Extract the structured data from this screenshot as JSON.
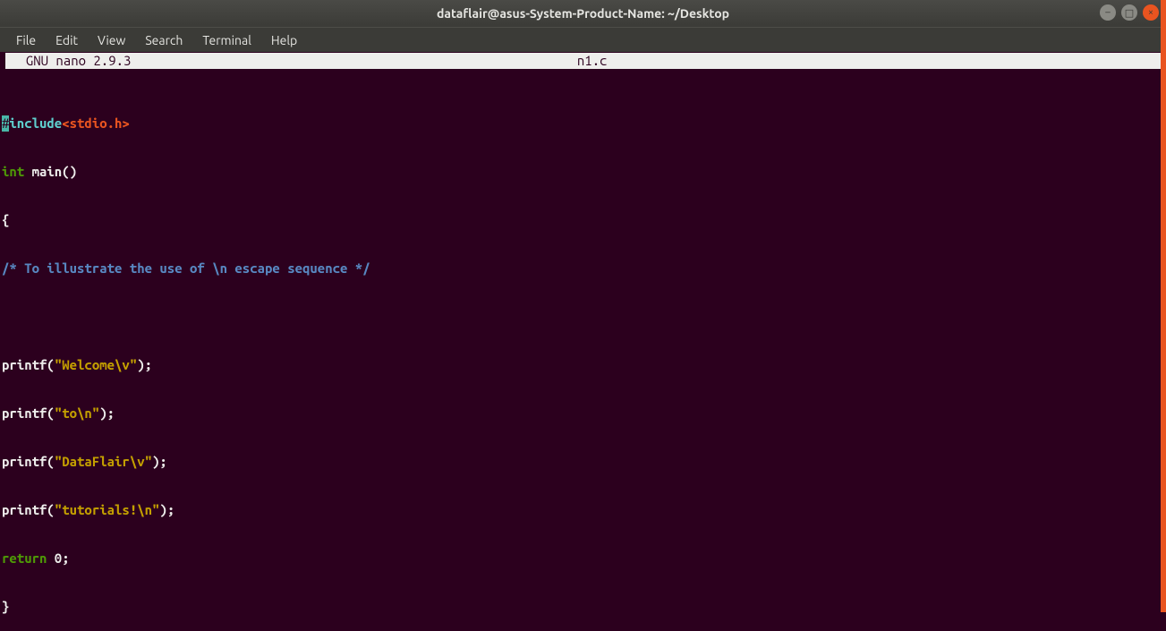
{
  "window": {
    "title": "dataflair@asus-System-Product-Name: ~/Desktop"
  },
  "controls": {
    "min": "–",
    "max": "□",
    "close": "×"
  },
  "menu": {
    "file": "File",
    "edit": "Edit",
    "view": "View",
    "search": "Search",
    "terminal": "Terminal",
    "help": "Help"
  },
  "nano": {
    "version": "  GNU nano 2.9.3",
    "filename": "n1.c"
  },
  "code": {
    "l1_hash": "#",
    "l1_include": "include",
    "l1_header": "<stdio.h>",
    "l2_int": "int",
    "l2_main": " main()",
    "l3": "{",
    "l4": "/* To illustrate the use of \\n escape sequence */",
    "l5": "",
    "l6a": "printf(",
    "l6b": "\"Welcome\\v\"",
    "l6c": ");",
    "l7a": "printf(",
    "l7b": "\"to\\n\"",
    "l7c": ");",
    "l8a": "printf(",
    "l8b": "\"DataFlair\\v\"",
    "l8c": ");",
    "l9a": "printf(",
    "l9b": "\"tutorials!\\n\"",
    "l9c": ");",
    "l10a": "return",
    "l10b": " 0;",
    "l11": "}"
  }
}
